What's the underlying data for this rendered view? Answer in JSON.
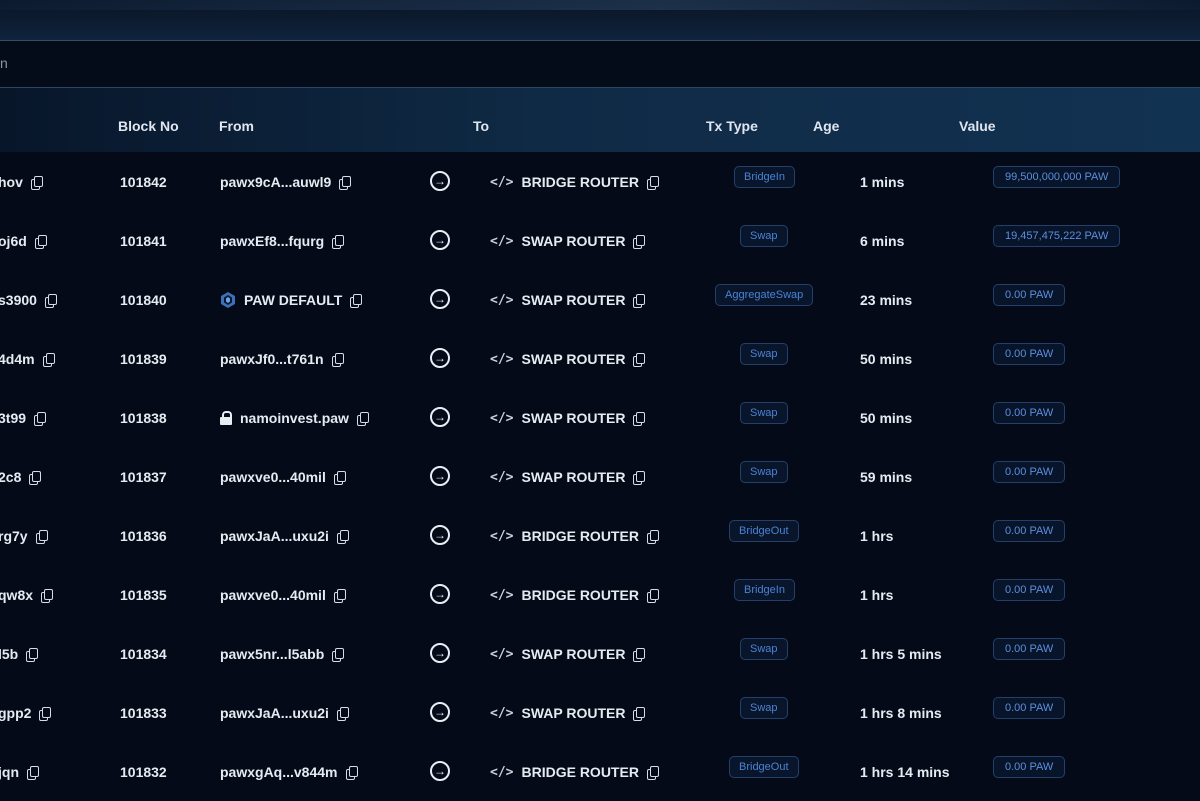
{
  "search": {
    "fragment": "n"
  },
  "table": {
    "headers": {
      "block_no": "Block No",
      "from": "From",
      "to": "To",
      "tx_type": "Tx Type",
      "age": "Age",
      "value": "Value"
    },
    "rows": [
      {
        "hash": "hov",
        "block": "101842",
        "from": "pawx9cA...auwl9",
        "from_kind": "plain",
        "to": "BRIDGE ROUTER",
        "tx_type": "BridgeIn",
        "age": "1 mins",
        "value": "99,500,000,000 PAW"
      },
      {
        "hash": "oj6d",
        "block": "101841",
        "from": "pawxEf8...fqurg",
        "from_kind": "plain",
        "to": "SWAP ROUTER",
        "tx_type": "Swap",
        "age": "6 mins",
        "value": "19,457,475,222 PAW"
      },
      {
        "hash": "s3900",
        "block": "101840",
        "from": "PAW DEFAULT",
        "from_kind": "logo",
        "to": "SWAP ROUTER",
        "tx_type": "AggregateSwap",
        "age": "23 mins",
        "value": "0.00 PAW"
      },
      {
        "hash": "4d4m",
        "block": "101839",
        "from": "pawxJf0...t761n",
        "from_kind": "plain",
        "to": "SWAP ROUTER",
        "tx_type": "Swap",
        "age": "50 mins",
        "value": "0.00 PAW"
      },
      {
        "hash": "3t99",
        "block": "101838",
        "from": "namoinvest.paw",
        "from_kind": "lock",
        "to": "SWAP ROUTER",
        "tx_type": "Swap",
        "age": "50 mins",
        "value": "0.00 PAW"
      },
      {
        "hash": "2c8",
        "block": "101837",
        "from": "pawxve0...40mil",
        "from_kind": "plain",
        "to": "SWAP ROUTER",
        "tx_type": "Swap",
        "age": "59 mins",
        "value": "0.00 PAW"
      },
      {
        "hash": "rg7y",
        "block": "101836",
        "from": "pawxJaA...uxu2i",
        "from_kind": "plain",
        "to": "BRIDGE ROUTER",
        "tx_type": "BridgeOut",
        "age": "1 hrs",
        "value": "0.00 PAW"
      },
      {
        "hash": "qw8x",
        "block": "101835",
        "from": "pawxve0...40mil",
        "from_kind": "plain",
        "to": "BRIDGE ROUTER",
        "tx_type": "BridgeIn",
        "age": "1 hrs",
        "value": "0.00 PAW"
      },
      {
        "hash": "l5b",
        "block": "101834",
        "from": "pawx5nr...l5abb",
        "from_kind": "plain",
        "to": "SWAP ROUTER",
        "tx_type": "Swap",
        "age": "1 hrs 5 mins",
        "value": "0.00 PAW"
      },
      {
        "hash": "gpp2",
        "block": "101833",
        "from": "pawxJaA...uxu2i",
        "from_kind": "plain",
        "to": "SWAP ROUTER",
        "tx_type": "Swap",
        "age": "1 hrs 8 mins",
        "value": "0.00 PAW"
      },
      {
        "hash": "jqn",
        "block": "101832",
        "from": "pawxgAq...v844m",
        "from_kind": "plain",
        "to": "BRIDGE ROUTER",
        "tx_type": "BridgeOut",
        "age": "1 hrs 14 mins",
        "value": "0.00 PAW"
      }
    ]
  },
  "icons": {
    "copy": "copy-icon",
    "arrow": "arrow-right-circle-icon",
    "code": "code-icon",
    "logo": "paw-logo-icon",
    "lock": "lock-icon"
  },
  "colors": {
    "background": "#040a17",
    "badge_text": "#4b83d6",
    "badge_border": "#24406a"
  }
}
